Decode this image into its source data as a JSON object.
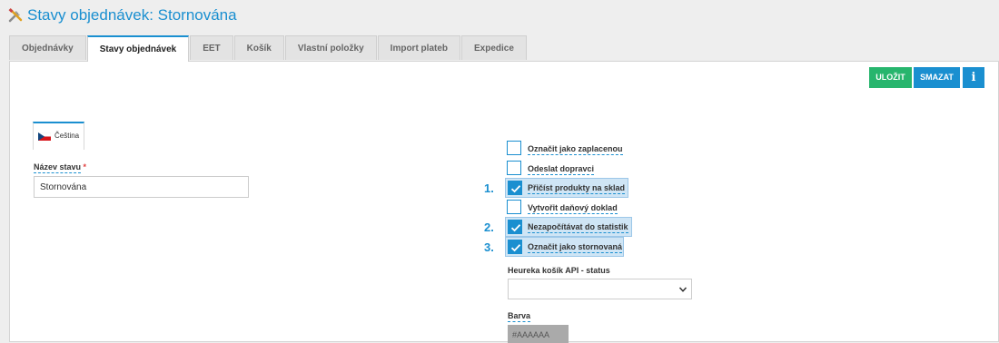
{
  "header": {
    "title": "Stavy objednávek: Stornována",
    "icon": "tools-icon"
  },
  "tabs": [
    {
      "label": "Objednávky",
      "active": false
    },
    {
      "label": "Stavy objednávek",
      "active": true
    },
    {
      "label": "EET",
      "active": false
    },
    {
      "label": "Košík",
      "active": false
    },
    {
      "label": "Vlastní položky",
      "active": false
    },
    {
      "label": "Import plateb",
      "active": false
    },
    {
      "label": "Expedice",
      "active": false
    }
  ],
  "toolbar": {
    "save_label": "ULOŽIT",
    "delete_label": "SMAZAT",
    "info_label": "i"
  },
  "language": {
    "label": "Čeština",
    "flag": "czech-flag-icon"
  },
  "form": {
    "name_label": "Název stavu",
    "required_mark": "*",
    "name_value": "Stornována",
    "heureka_label": "Heureka košík API - status",
    "heureka_value": "",
    "color_label": "Barva",
    "color_value": "#AAAAAA"
  },
  "checkboxes": [
    {
      "label": "Označit jako zaplacenou",
      "checked": false,
      "step": ""
    },
    {
      "label": "Odeslat dopravci",
      "checked": false,
      "step": ""
    },
    {
      "label": "Přičíst produkty na sklad",
      "checked": true,
      "step": "1."
    },
    {
      "label": "Vytvořit daňový doklad",
      "checked": false,
      "step": ""
    },
    {
      "label": "Nezapočítávat do statistik",
      "checked": true,
      "step": "2."
    },
    {
      "label": "Označit jako stornovaná",
      "checked": true,
      "step": "3."
    }
  ],
  "colors": {
    "accent": "#1a8fd0",
    "save": "#27b56d",
    "highlight": "#cfe5f5"
  }
}
